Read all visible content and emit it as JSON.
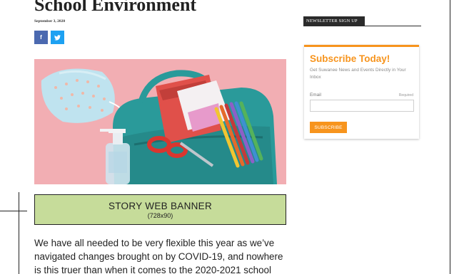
{
  "article": {
    "title": "School Environment",
    "date": "September 3, 2020",
    "body_lines": [
      "We have all needed to be very flexible this year as we’ve",
      "navigated changes brought on by COVID-19, and nowhere",
      "is this truer than when it comes to the 2020-2021 school"
    ]
  },
  "share": {
    "facebook_glyph": "f",
    "twitter_glyph": "🐦",
    "facebook_icon": "facebook-icon",
    "twitter_icon": "twitter-icon"
  },
  "banner": {
    "title": "STORY WEB BANNER",
    "size": "(728x90)"
  },
  "sidebar": {
    "tab_label": "NEWSLETTER SIGN UP",
    "card": {
      "title": "Subscribe Today!",
      "subtitle": "Get Suwanee News and Events Directly in Your Inbox",
      "email_label": "Email",
      "required_label": "Required",
      "email_value": "",
      "button_label": "SUBSCRIBE"
    }
  },
  "colors": {
    "accent_orange": "#f7941d",
    "facebook_blue": "#4b69b0",
    "twitter_blue": "#1da1f2",
    "banner_green": "#c6dc9a",
    "tab_dark": "#2b2b2b"
  }
}
